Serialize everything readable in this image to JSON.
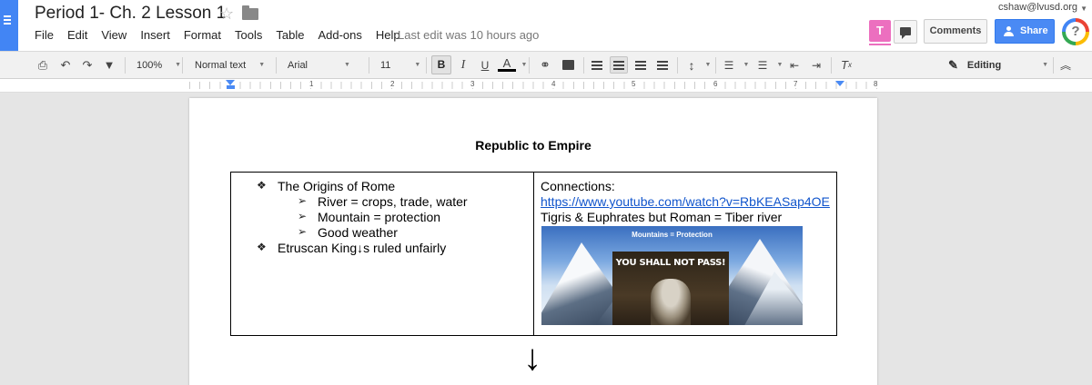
{
  "header": {
    "title": "Period 1- Ch. 2 Lesson 1",
    "user_email": "cshaw@lvusd.org",
    "last_edit": "Last edit was 10 hours ago",
    "avatar_letter": "T",
    "comments_label": "Comments",
    "share_label": "Share",
    "help_glyph": "?"
  },
  "menu": [
    "File",
    "Edit",
    "View",
    "Insert",
    "Format",
    "Tools",
    "Table",
    "Add-ons",
    "Help"
  ],
  "toolbar": {
    "zoom": "100%",
    "style": "Normal text",
    "font": "Arial",
    "font_size": "11",
    "bold": "B",
    "italic": "I",
    "underline": "U",
    "text_color": "A",
    "mode": "Editing"
  },
  "ruler": {
    "numbers": [
      "1",
      "2",
      "3",
      "4",
      "5",
      "6",
      "7",
      "8"
    ]
  },
  "document": {
    "heading": "Republic to Empire",
    "left_cell": {
      "bullet_1": "The Origins of Rome",
      "sub_1": "River = crops, trade, water",
      "sub_2": "Mountain = protection",
      "sub_3": "Good weather",
      "bullet_2": "Etruscan King↓s ruled unfairly"
    },
    "right_cell": {
      "connections": "Connections:",
      "link": "https://www.youtube.com/watch?v=RbKEASap4OE",
      "note": "Tigris & Euphrates but Roman = Tiber river",
      "image_caption": "Mountains = Protection",
      "image_text": "YOU SHALL NOT PASS!"
    },
    "arrow": "↓"
  },
  "colors": {
    "accent": "#4285f4",
    "share": "#4a8af4",
    "link": "#1155cc",
    "avatar": "#ec6fbf"
  }
}
